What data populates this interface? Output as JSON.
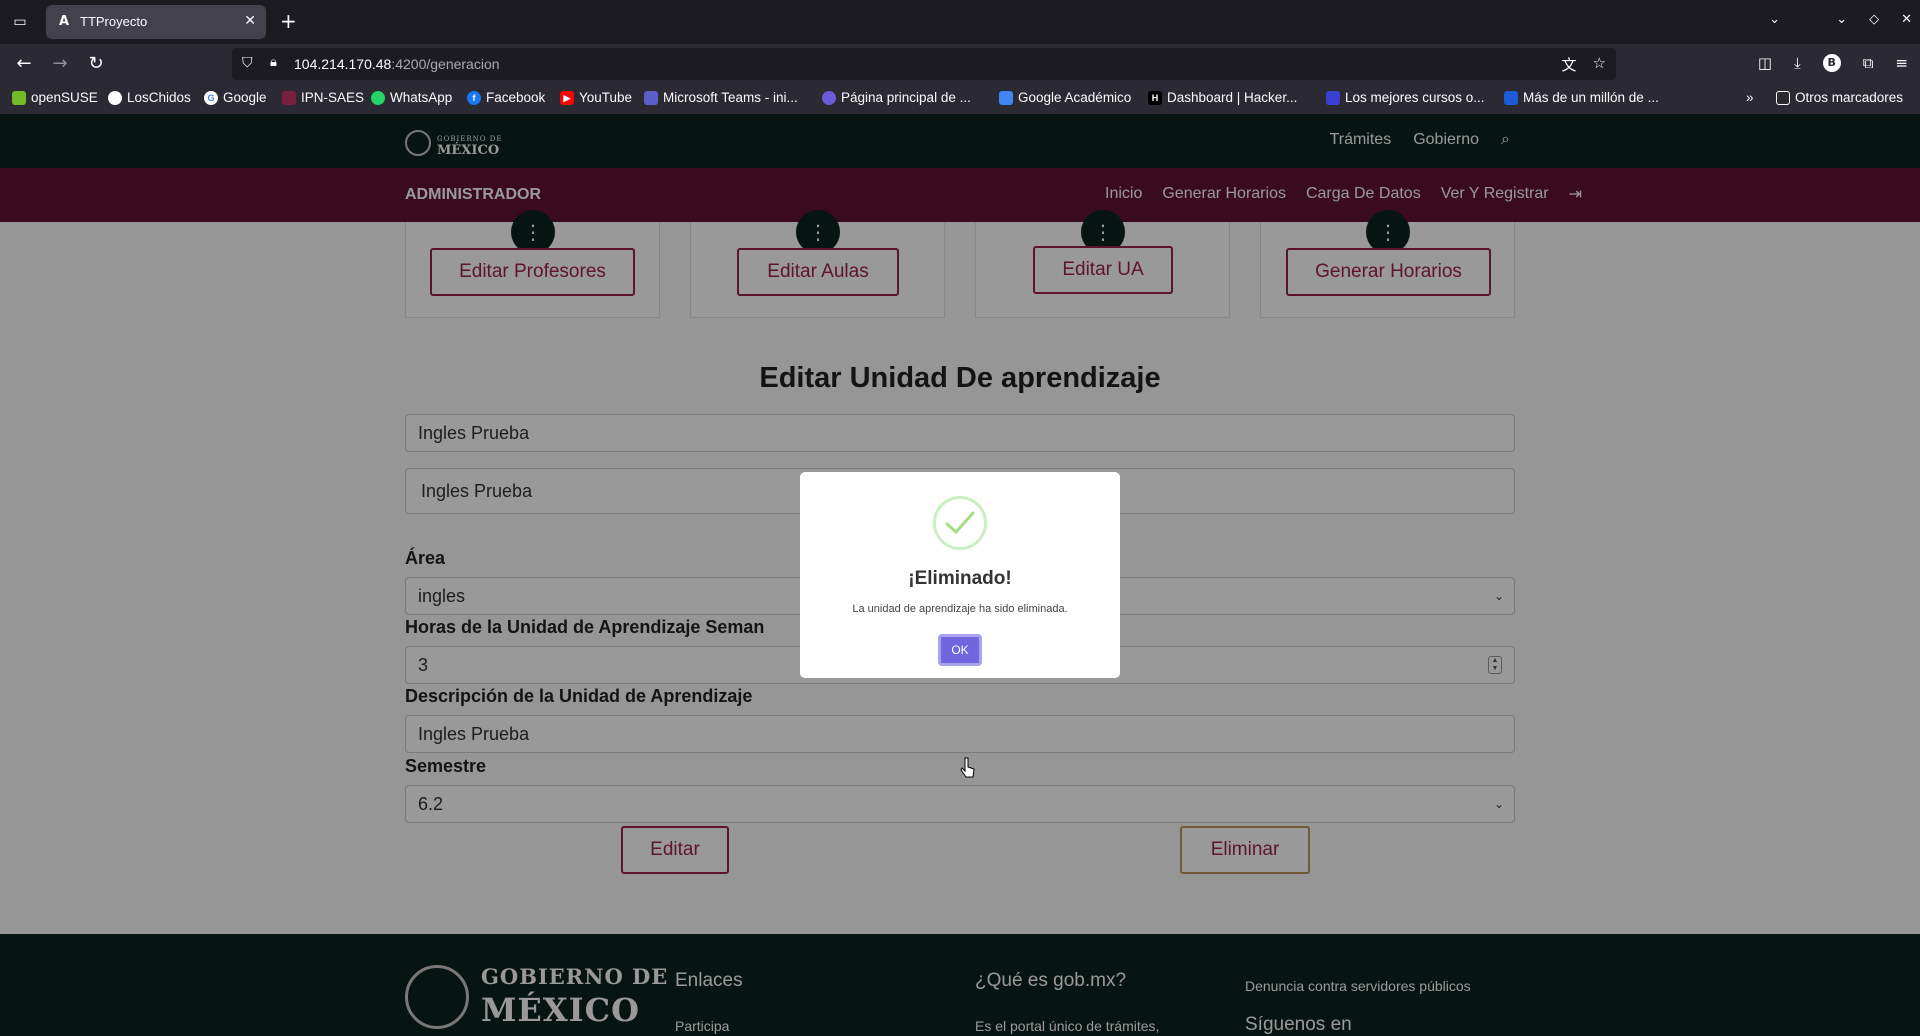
{
  "browser": {
    "tab_title": "TTProyecto",
    "tab_favicon": "A",
    "url_host": "104.214.170.48",
    "url_path": ":4200/generacion",
    "profile_letter": "B",
    "bookmarks": [
      "openSUSE",
      "LosChidos",
      "Google",
      "IPN-SAES",
      "WhatsApp",
      "Facebook",
      "YouTube",
      "Microsoft Teams - ini...",
      "Página principal de ...",
      "Google Académico",
      "Dashboard | Hacker...",
      "Los mejores cursos o...",
      "Más de un millón de ..."
    ],
    "other_bookmarks": "Otros marcadores"
  },
  "header": {
    "logo_small": "GOBIERNO DE",
    "logo_big": "MÉXICO",
    "nav": [
      "Trámites",
      "Gobierno"
    ]
  },
  "admin": {
    "title": "ADMINISTRADOR",
    "nav": [
      "Inicio",
      "Generar Horarios",
      "Carga De Datos",
      "Ver Y Registrar"
    ]
  },
  "cards": [
    "Editar Profesores",
    "Editar Aulas",
    "Editar UA",
    "Generar Horarios"
  ],
  "form": {
    "title": "Editar Unidad De aprendizaje",
    "field1_value": "Ingles Prueba",
    "field2_value": "Ingles Prueba",
    "area_label": "Área",
    "area_value": "ingles",
    "hours_label": "Horas de la Unidad de Aprendizaje Seman",
    "hours_value": "3",
    "desc_label": "Descripción de la Unidad de Aprendizaje",
    "desc_value": "Ingles Prueba",
    "semester_label": "Semestre",
    "semester_value": "6.2",
    "edit_button": "Editar",
    "delete_button": "Eliminar"
  },
  "footer": {
    "logo_line1": "GOBIERNO DE",
    "logo_line2": "MÉXICO",
    "links_title": "Enlaces",
    "links_item": "Participa",
    "what_title": "¿Qué es gob.mx?",
    "what_text": "Es el portal único de trámites,",
    "complaint": "Denuncia contra servidores públicos",
    "follow": "Síguenos en"
  },
  "modal": {
    "title": "¡Eliminado!",
    "text": "La unidad de aprendizaje ha sido eliminada.",
    "ok_button": "OK"
  }
}
